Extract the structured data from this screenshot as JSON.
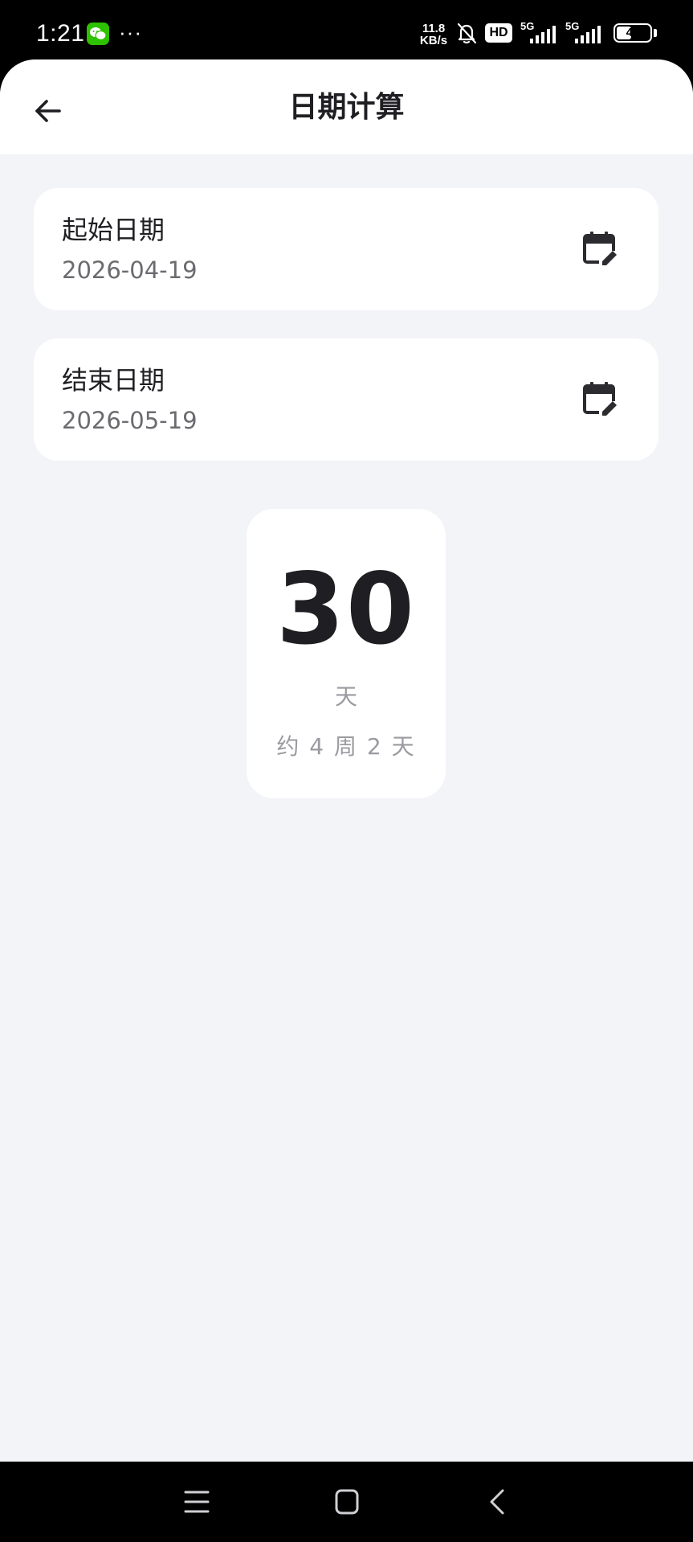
{
  "status_bar": {
    "time": "1:21",
    "more": "···",
    "net_speed_value": "11.8",
    "net_speed_unit": "KB/s",
    "hd_label": "HD",
    "signal_1_label": "5G",
    "signal_2_label": "5G",
    "battery_level": "46",
    "battery_fraction": 0.46,
    "icons": [
      "wechat-icon",
      "bell-mute-icon",
      "hd-icon",
      "signal-5g-icon",
      "battery-icon"
    ]
  },
  "header": {
    "title": "日期计算",
    "back_icon": "arrow-left-icon"
  },
  "start_date": {
    "label": "起始日期",
    "value": "2026-04-19",
    "icon": "calendar-edit-icon"
  },
  "end_date": {
    "label": "结束日期",
    "value": "2026-05-19",
    "icon": "calendar-edit-icon"
  },
  "result": {
    "days": "30",
    "unit": "天",
    "weeks_text": "约 4 周 2 天"
  },
  "nav_bar": {
    "icons": [
      "menu-icon",
      "home-icon",
      "back-icon"
    ]
  },
  "colors": {
    "background": "#f3f4f8",
    "card": "#ffffff",
    "text_primary": "#1f1f23",
    "text_secondary": "#6b6b70",
    "text_muted": "#9a9aa0",
    "wechat_green": "#2dc100"
  }
}
